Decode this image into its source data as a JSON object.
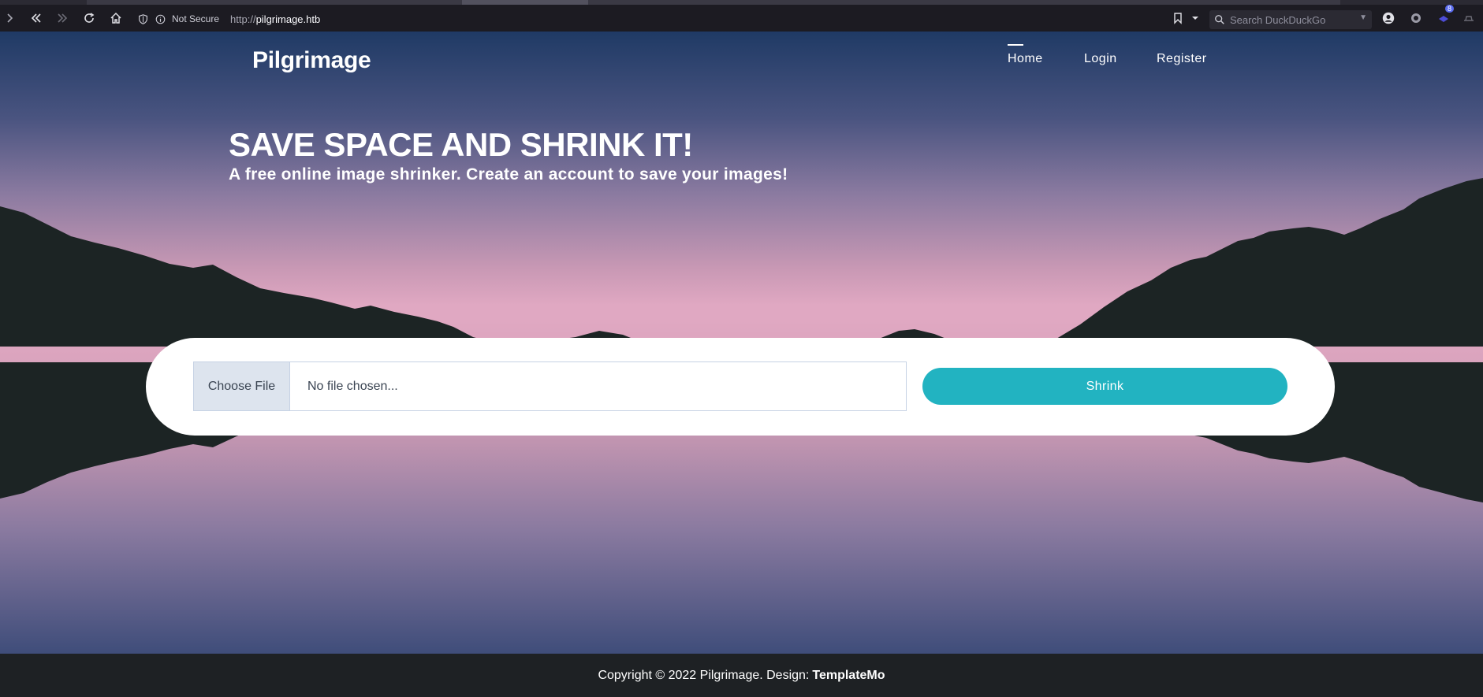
{
  "browser": {
    "not_secure_label": "Not Secure",
    "url_protocol": "http://",
    "url_host": "pilgrimage.htb",
    "search_placeholder": "Search DuckDuckGo",
    "extension_badge": "8"
  },
  "site": {
    "brand": "Pilgrimage",
    "nav": {
      "home": "Home",
      "login": "Login",
      "register": "Register"
    },
    "hero": {
      "title": "SAVE SPACE AND SHRINK IT!",
      "subtitle": "A free online image shrinker. Create an account to save your images!"
    },
    "upload": {
      "choose_label": "Choose File",
      "file_status": "No file chosen...",
      "submit_label": "Shrink"
    },
    "footer": {
      "text": "Copyright © 2022 Pilgrimage. Design:",
      "designer": "TemplateMo"
    }
  },
  "colors": {
    "accent": "#22b3c1",
    "footer_bg": "#1e2124",
    "mountain": "#1c2424"
  }
}
